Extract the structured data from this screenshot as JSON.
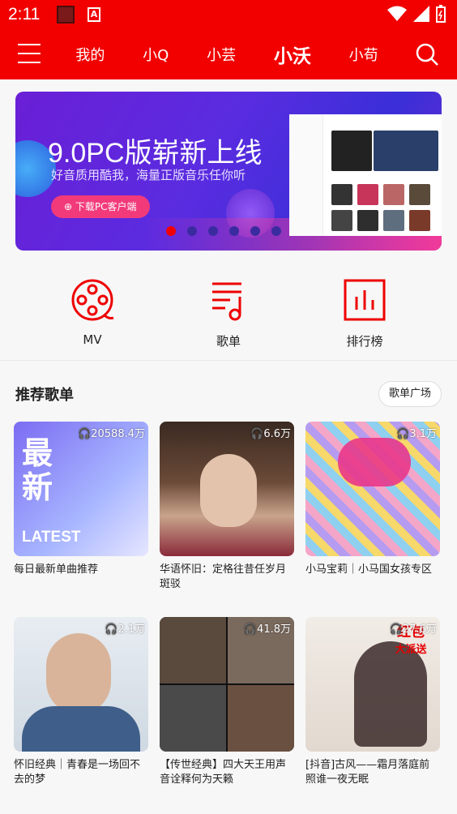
{
  "status_bar": {
    "time": "2:11"
  },
  "header": {
    "tabs": [
      {
        "label": "我的",
        "active": false
      },
      {
        "label": "小Q",
        "active": false
      },
      {
        "label": "小芸",
        "active": false
      },
      {
        "label": "小沃",
        "active": true
      },
      {
        "label": "小苟",
        "active": false
      }
    ]
  },
  "banner": {
    "title": "9.0PC版崭新上线",
    "subtitle": "好音质用酷我，海量正版音乐任你听",
    "button_label": "下载PC客户端",
    "slide_count": 6,
    "active_slide": 0
  },
  "quick_actions": [
    {
      "label": "MV",
      "icon": "film-reel-icon"
    },
    {
      "label": "歌单",
      "icon": "playlist-icon"
    },
    {
      "label": "排行榜",
      "icon": "chart-icon"
    }
  ],
  "section": {
    "title": "推荐歌单",
    "more_label": "歌单广场"
  },
  "playlists": [
    {
      "count": "20588.4万",
      "title": "每日最新单曲推荐",
      "cover_text_1": "最",
      "cover_text_2": "新",
      "cover_text_3": "LATEST"
    },
    {
      "count": "6.6万",
      "title": "华语怀旧：定格往昔任岁月斑驳"
    },
    {
      "count": "3.1万",
      "title": "小马宝莉｜小马国女孩专区"
    },
    {
      "count": "2.1万",
      "title": "怀旧经典｜青春是一场回不去的梦"
    },
    {
      "count": "41.8万",
      "title": "【传世经典】四大天王用声音诠释何为天籁"
    },
    {
      "count": "27.6万",
      "title": "[抖音]古风——霜月落庭前照谁一夜无眠",
      "cover_text_1": "红包",
      "cover_text_2": "大派送"
    }
  ],
  "colors": {
    "brand": "#f20000",
    "accent_pink": "#f23a7a"
  }
}
